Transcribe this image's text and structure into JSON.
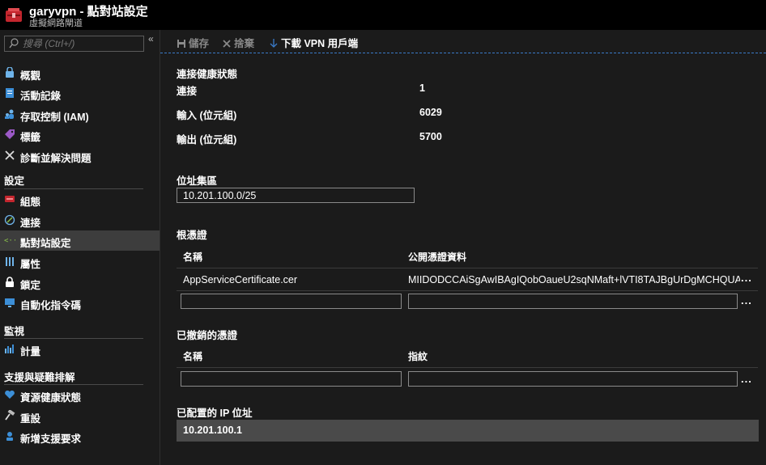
{
  "header": {
    "title": "garyvpn - 點對站設定",
    "subtitle": "虛擬網路閘道"
  },
  "sidebar": {
    "search_placeholder": "搜尋 (Ctrl+/)",
    "collapse_label": "«",
    "items": [
      {
        "label": "概觀",
        "icon": "overview-icon"
      },
      {
        "label": "活動記錄",
        "icon": "activity-log-icon"
      },
      {
        "label": "存取控制 (IAM)",
        "icon": "iam-icon"
      },
      {
        "label": "標籤",
        "icon": "tag-icon"
      },
      {
        "label": "診斷並解決問題",
        "icon": "wrench-icon"
      }
    ],
    "section_settings": "設定",
    "settings_items": [
      {
        "label": "組態",
        "icon": "configuration-icon"
      },
      {
        "label": "連接",
        "icon": "connections-icon"
      },
      {
        "label": "點對站設定",
        "icon": "p2s-icon",
        "active": true
      },
      {
        "label": "屬性",
        "icon": "properties-icon"
      },
      {
        "label": "鎖定",
        "icon": "lock-icon"
      },
      {
        "label": "自動化指令碼",
        "icon": "automation-icon"
      }
    ],
    "section_monitoring": "監視",
    "monitoring_items": [
      {
        "label": "計量",
        "icon": "metrics-icon"
      }
    ],
    "section_support": "支援與疑難排解",
    "support_items": [
      {
        "label": "資源健康狀態",
        "icon": "heart-icon"
      },
      {
        "label": "重設",
        "icon": "hammer-icon"
      },
      {
        "label": "新增支援要求",
        "icon": "support-icon"
      }
    ]
  },
  "toolbar": {
    "save_label": "儲存",
    "discard_label": "捨棄",
    "download_label": "下載 VPN 用戶端"
  },
  "main": {
    "health": {
      "title": "連接健康狀態",
      "connection_label": "連接",
      "connection_value": "1",
      "ingress_label": "輸入 (位元組)",
      "ingress_value": "6029",
      "egress_label": "輸出 (位元組)",
      "egress_value": "5700"
    },
    "address_pool": {
      "title": "位址集區",
      "value": "10.201.100.0/25"
    },
    "root_certs": {
      "title": "根憑證",
      "col_name": "名稱",
      "col_data": "公開憑證資料",
      "rows": [
        {
          "name": "AppServiceCertificate.cer",
          "data": "MIIDODCCAiSgAwIBAgIQobOaueU2sqNMaft+lVTI8TAJBgUrDgMCHQUA"
        }
      ],
      "more": "..."
    },
    "revoked_certs": {
      "title": "已撤銷的憑證",
      "col_name": "名稱",
      "col_thumbprint": "指紋",
      "more": "..."
    },
    "allocated_ip": {
      "title": "已配置的 IP 位址",
      "value": "10.201.100.1"
    }
  },
  "colors": {
    "background": "#1b1b1b",
    "titlebar": "#000000",
    "active_nav": "#3d3d3d",
    "accent_blue": "#3a7bc8",
    "brand_red": "#c4262e"
  }
}
